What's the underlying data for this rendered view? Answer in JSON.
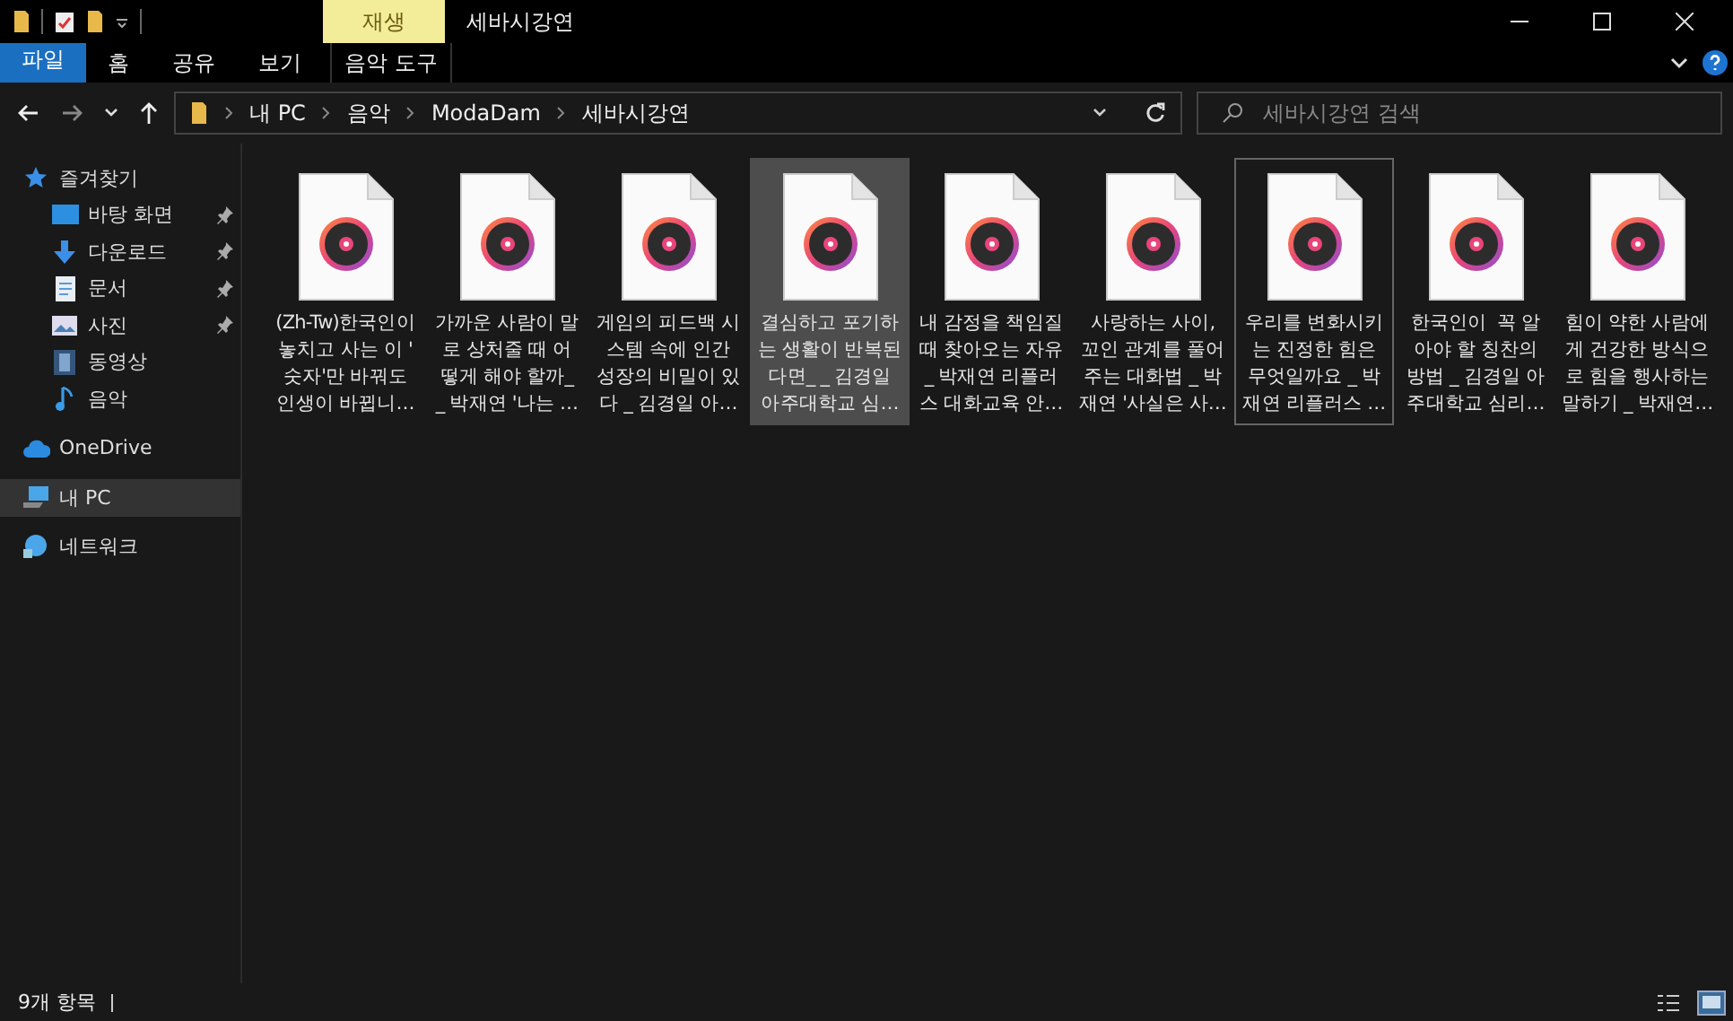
{
  "window": {
    "title": "세바시강연",
    "context_tab": "재생"
  },
  "ribbon": {
    "tabs": [
      {
        "label": "파일",
        "kind": "file"
      },
      {
        "label": "홈",
        "kind": "tab"
      },
      {
        "label": "공유",
        "kind": "tab"
      },
      {
        "label": "보기",
        "kind": "tab"
      },
      {
        "label": "음악 도구",
        "kind": "context"
      }
    ]
  },
  "address": {
    "breadcrumbs": [
      "내 PC",
      "음악",
      "ModaDam",
      "세바시강연"
    ]
  },
  "search": {
    "placeholder": "세바시강연 검색"
  },
  "sidebar": {
    "items": [
      {
        "label": "즐겨찾기",
        "kind": "star",
        "selected": false,
        "children": [
          {
            "label": "바탕 화면",
            "kind": "desktop",
            "pinned": true,
            "selected": false
          },
          {
            "label": "다운로드",
            "kind": "download",
            "pinned": true,
            "selected": false
          },
          {
            "label": "문서",
            "kind": "document",
            "pinned": true,
            "selected": false
          },
          {
            "label": "사진",
            "kind": "picture",
            "pinned": true,
            "selected": false
          },
          {
            "label": "동영상",
            "kind": "video",
            "pinned": false,
            "selected": false
          },
          {
            "label": "음악",
            "kind": "music",
            "pinned": false,
            "selected": false
          }
        ]
      },
      {
        "label": "OneDrive",
        "kind": "cloud",
        "selected": false
      },
      {
        "label": "내 PC",
        "kind": "pc",
        "selected": true
      },
      {
        "label": "네트워크",
        "kind": "network",
        "selected": false
      }
    ]
  },
  "files": [
    {
      "lines": [
        "(Zh-Tw)한국인이",
        "놓치고 사는 이 '",
        "숫자'만 바꿔도",
        "인생이 바뀝니…"
      ],
      "selected": false,
      "focused": false
    },
    {
      "lines": [
        "가까운 사람이 말",
        "로 상처줄 때 어",
        "떻게 해야 할까_",
        "_ 박재연 '나는 …"
      ],
      "selected": false,
      "focused": false
    },
    {
      "lines": [
        "게임의 피드백 시",
        "스템 속에 인간",
        "성장의 비밀이 있",
        "다 _ 김경일 아…"
      ],
      "selected": false,
      "focused": false
    },
    {
      "lines": [
        "결심하고 포기하",
        "는 생활이 반복된",
        "다면_ _ 김경일",
        "아주대학교 심…"
      ],
      "selected": true,
      "focused": false
    },
    {
      "lines": [
        "내 감정을 책임질",
        "때 찾아오는 자유",
        "_ 박재연 리플러",
        "스 대화교육 안…"
      ],
      "selected": false,
      "focused": false
    },
    {
      "lines": [
        "사랑하는 사이,",
        "꼬인 관계를 풀어",
        "주는 대화법 _ 박",
        "재연 '사실은 사…"
      ],
      "selected": false,
      "focused": false
    },
    {
      "lines": [
        "우리를 변화시키",
        "는 진정한 힘은",
        "무엇일까요 _ 박",
        "재연 리플러스 …"
      ],
      "selected": false,
      "focused": true
    },
    {
      "lines": [
        "한국인이  꼭 알",
        "아야 할 칭찬의",
        "방법 _ 김경일 아",
        "주대학교 심리…"
      ],
      "selected": false,
      "focused": false
    },
    {
      "lines": [
        "힘이 약한 사람에",
        "게 건강한 방식으",
        "로 힘을 행사하는",
        "말하기 _ 박재연…"
      ],
      "selected": false,
      "focused": false
    }
  ],
  "status_bar": {
    "text": "9개 항목"
  }
}
